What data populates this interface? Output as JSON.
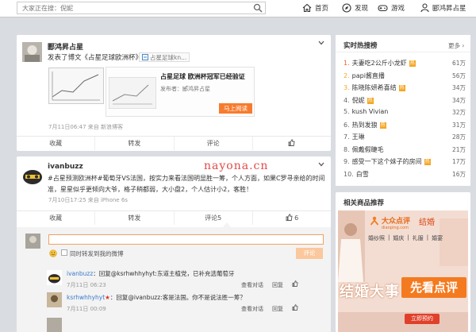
{
  "search": {
    "placeholder": "大家正在搜：倪妮"
  },
  "nav": {
    "home": "首页",
    "discover": "发现",
    "game": "游戏",
    "user": "郾鸿昇占星"
  },
  "post1": {
    "author": "郾鸿昇占星",
    "text": "发表了博文《占星足球欧洲杯》",
    "link": "占星足球kn...",
    "article_title": "占星足球 欧洲杯冠军已经验证",
    "publisher": "发布者：郾鸿昇占星",
    "read_button": "马上阅读",
    "time": "7月11日06:47 来自 新浪博客",
    "actions": {
      "fav": "收藏",
      "repost": "转发",
      "comment": "评论"
    }
  },
  "watermark": "nayona.cn",
  "post2": {
    "author": "ivanbuzz",
    "text": "#占星预测欧洲杯#葡萄牙VS法国，按实力来看法国明显胜一筹，个人方面，如果C罗寻亲给的时间准，星星似乎更倾向大爷，格子稍都弱，大小盘2，个人估计小2，客胜！",
    "time": "7月10日17:25 来自 iPhone 6s",
    "actions": {
      "fav": "收藏",
      "repost": "转发",
      "comment": "评论5",
      "like": "6"
    }
  },
  "composer": {
    "checkbox_label": "同时转发到我的微博",
    "submit": "评论"
  },
  "comments": [
    {
      "author": "ivanbuzz",
      "text": "：回复@ksrhwhhyhyt:东道主植党，已补充选葡萄牙",
      "time": "7月11日 06:23",
      "view": "查看对话",
      "reply": "回复"
    },
    {
      "author": "ksrhwhhyhyt",
      "text": "：回复@ivanbuzz:客是法国。你不是说法胜一筹？",
      "time": "7月11日 00:09",
      "view": "查看对话",
      "reply": "回复"
    }
  ],
  "hotlist": {
    "title": "实时热搜榜",
    "more": "更多",
    "items": [
      {
        "rank": "1.",
        "text": "夫妻吃2公斤小龙虾",
        "hot": true,
        "count": "61万"
      },
      {
        "rank": "2.",
        "text": "papi酱直播",
        "hot": false,
        "count": "56万"
      },
      {
        "rank": "3.",
        "text": "陈晓陈妍希喜结",
        "hot": true,
        "count": "34万"
      },
      {
        "rank": "4.",
        "text": "倪妮",
        "hot": true,
        "count": "34万"
      },
      {
        "rank": "5.",
        "text": "kush Vivian",
        "hot": false,
        "count": "32万"
      },
      {
        "rank": "6.",
        "text": "热到发狼",
        "hot": true,
        "count": "31万"
      },
      {
        "rank": "7.",
        "text": "王琳",
        "hot": false,
        "count": "28万"
      },
      {
        "rank": "8.",
        "text": "佩戴假睫毛",
        "hot": false,
        "count": "21万"
      },
      {
        "rank": "9.",
        "text": "感受一下这个妹子的房间",
        "hot": true,
        "count": "17万"
      },
      {
        "rank": "10.",
        "text": "白雪",
        "hot": false,
        "count": "16万"
      }
    ]
  },
  "goods": {
    "title": "相关商品推荐",
    "brand": "大众点评",
    "brand_sub": "dianping.com",
    "wedding": "结婚",
    "cats": [
      "婚纱照",
      "婚庆",
      "礼服",
      "婚宴"
    ],
    "headline": "结婚大事",
    "headline2": "先看点评",
    "cta": "立即预约"
  }
}
